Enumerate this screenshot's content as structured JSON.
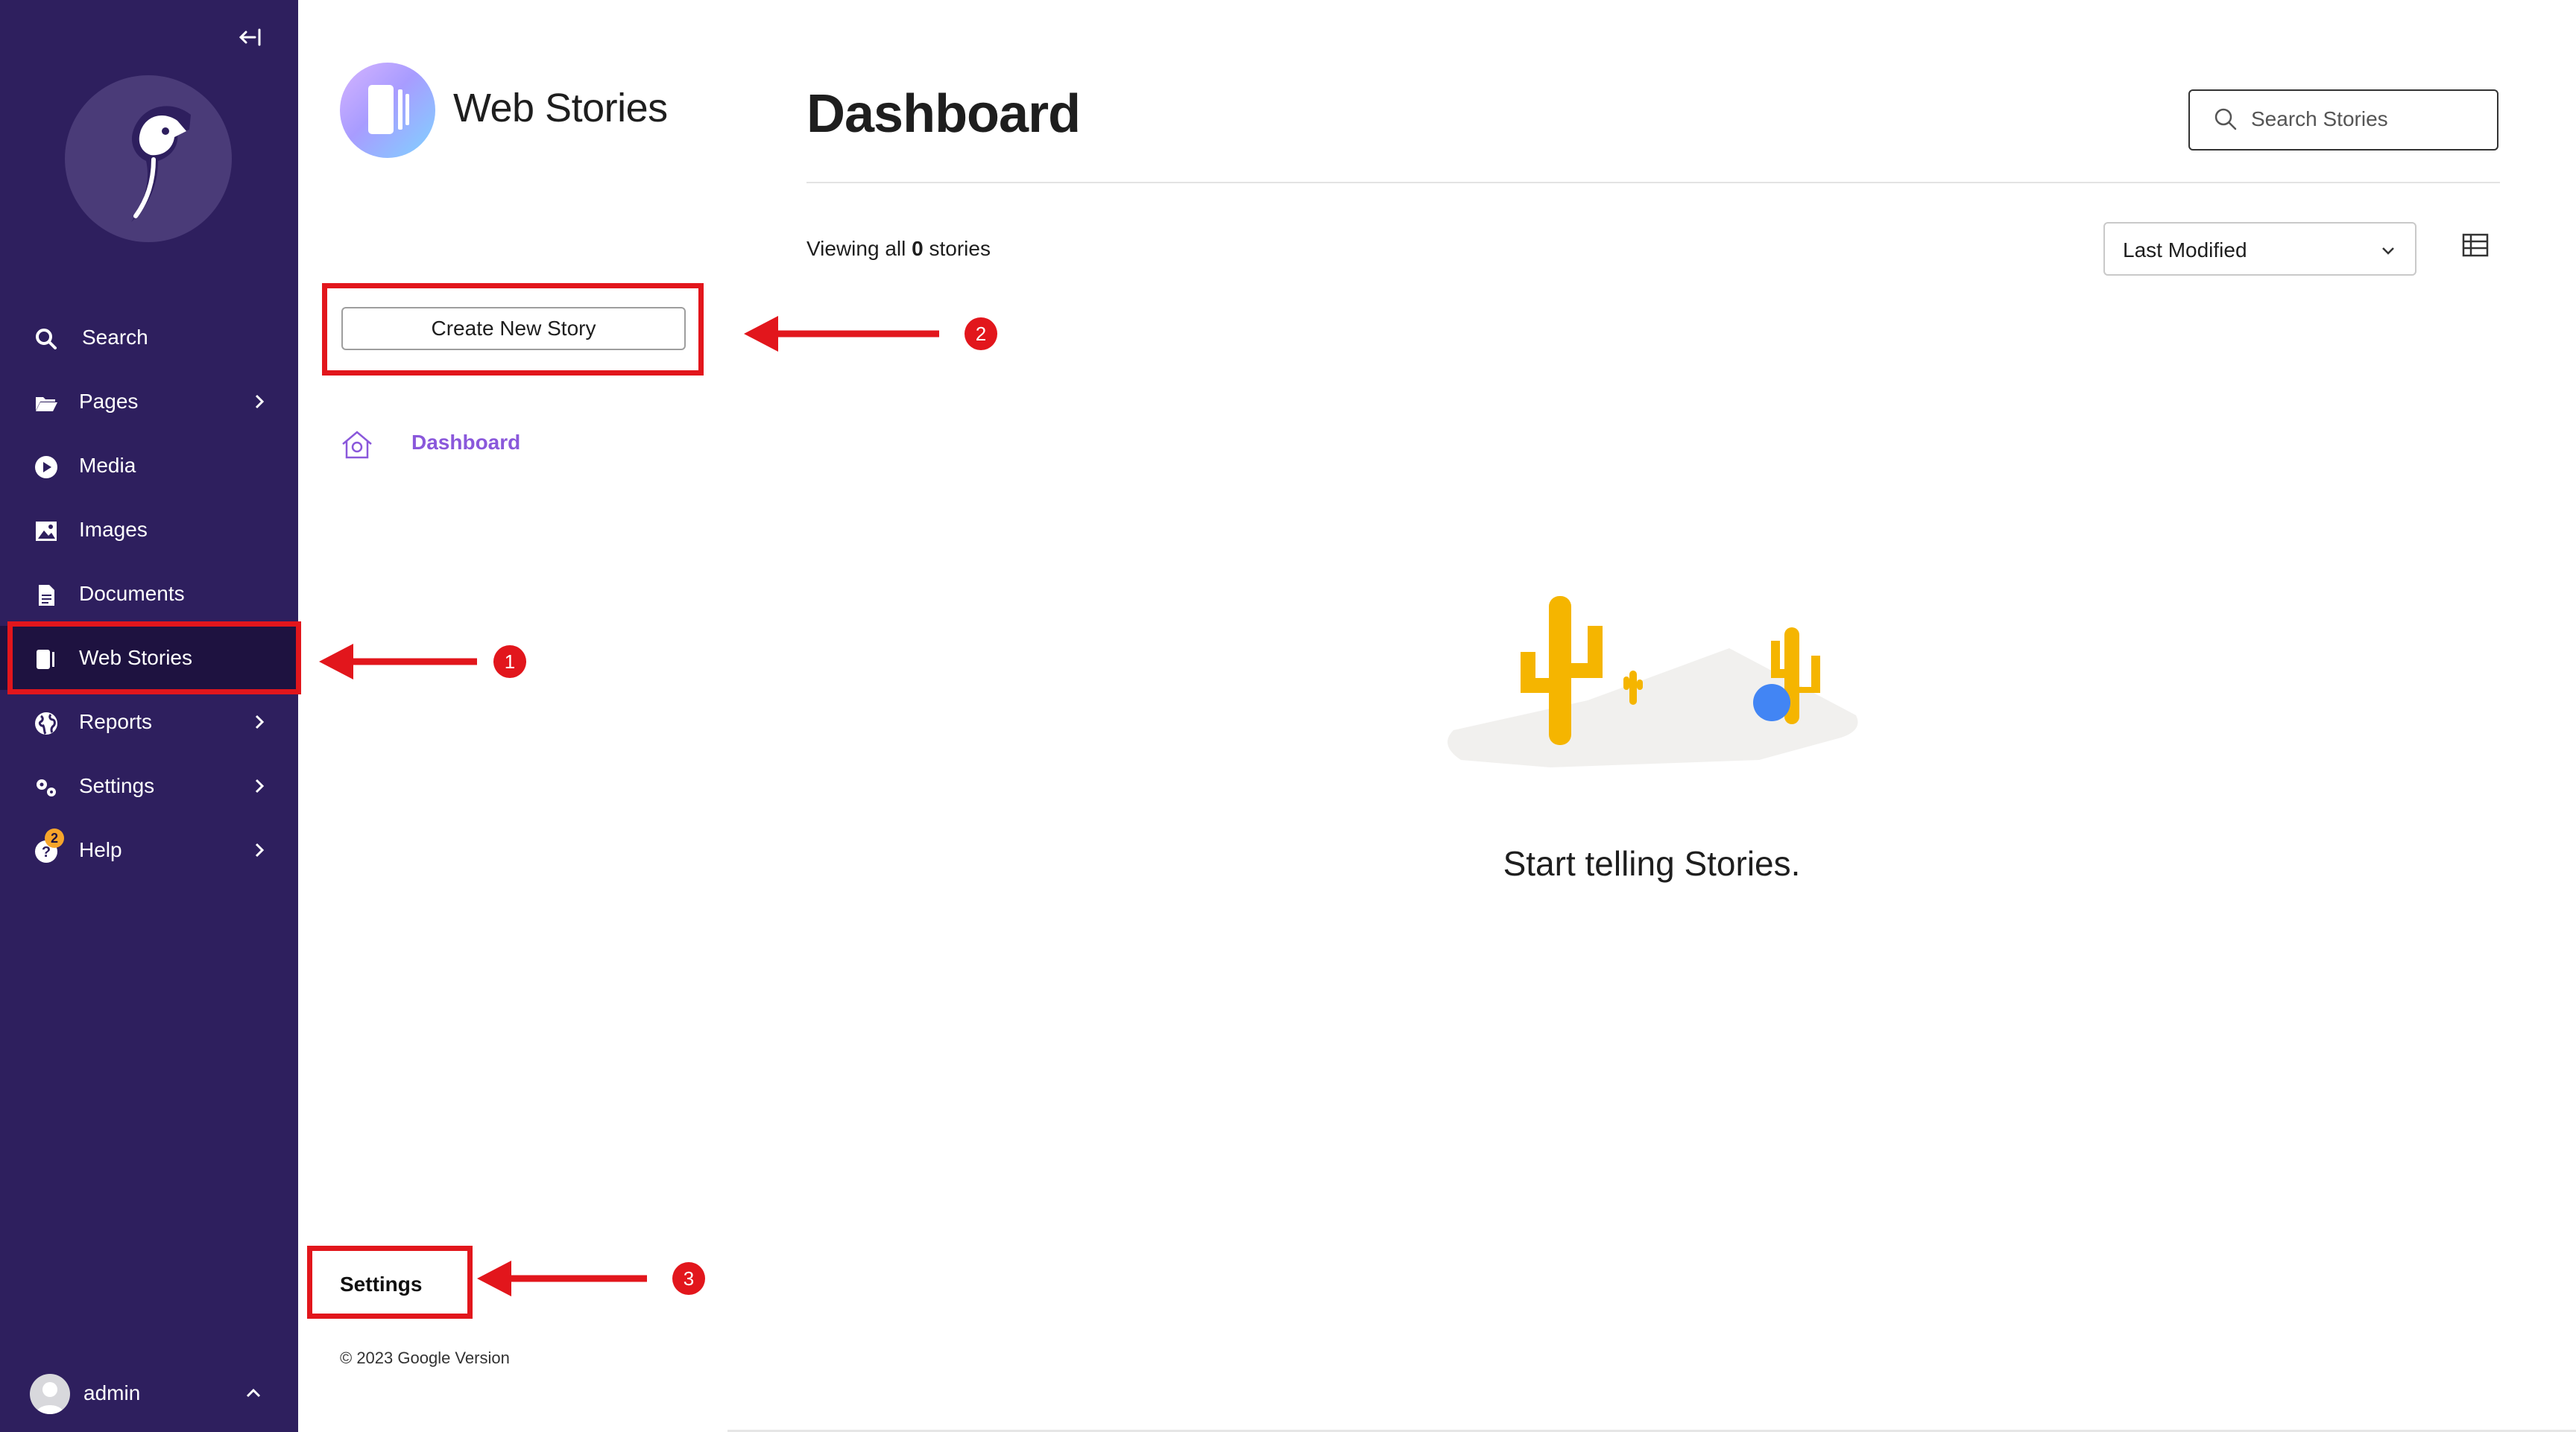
{
  "sidebar": {
    "items": [
      {
        "label": "Search",
        "icon": "search-icon"
      },
      {
        "label": "Pages",
        "icon": "folder-open-icon"
      },
      {
        "label": "Media",
        "icon": "media-play-icon"
      },
      {
        "label": "Images",
        "icon": "image-icon"
      },
      {
        "label": "Documents",
        "icon": "doc-icon"
      },
      {
        "label": "Web Stories",
        "icon": "web-stories-icon"
      },
      {
        "label": "Reports",
        "icon": "globe-icon"
      },
      {
        "label": "Settings",
        "icon": "cogs-icon"
      },
      {
        "label": "Help",
        "icon": "help-icon"
      }
    ],
    "help_badge": "2",
    "account_label": "admin"
  },
  "panel": {
    "app_title": "Web Stories",
    "create_button": "Create New Story",
    "dashboard_link": "Dashboard",
    "settings_link": "Settings",
    "copyright": "© 2023 Google Version"
  },
  "main": {
    "title": "Dashboard",
    "search_placeholder": "Search Stories",
    "viewing_prefix": "Viewing all ",
    "viewing_count": "0",
    "viewing_suffix": " stories",
    "sort_label": "Last Modified",
    "empty_message": "Start telling Stories."
  },
  "annotations": {
    "markers": [
      "1",
      "2",
      "3"
    ]
  },
  "colors": {
    "sidebar_bg": "#2e1f5e",
    "sidebar_active": "#1e1240",
    "accent_purple": "#8a58db",
    "annotation_red": "#e2161c",
    "cactus_yellow": "#f5b500",
    "ball_blue": "#4285f4"
  }
}
